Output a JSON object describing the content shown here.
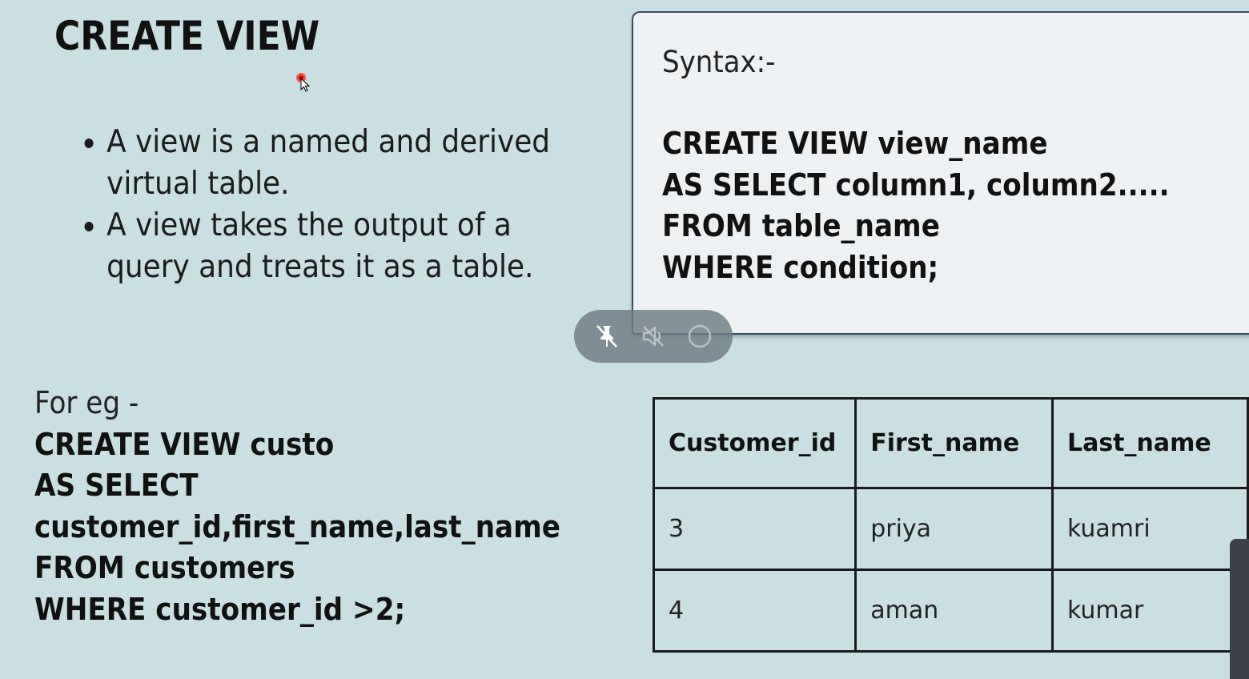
{
  "slide": {
    "title": "CREATE  VIEW",
    "bullets": [
      "A view is a named and derived virtual table.",
      "A view takes the output of a query and treats it as a table."
    ]
  },
  "syntax": {
    "heading": "Syntax:-",
    "lines": [
      "CREATE VIEW view_name",
      "AS SELECT column1, column2.....",
      "FROM table_name",
      "WHERE condition;"
    ]
  },
  "example": {
    "intro": "For eg -",
    "lines": [
      "CREATE VIEW custo",
      "AS SELECT",
      "customer_id,first_name,last_name",
      "FROM customers",
      "WHERE customer_id >2;"
    ]
  },
  "table": {
    "columns": [
      "Customer_id",
      "First_name",
      "Last_name"
    ],
    "rows": [
      [
        "3",
        "priya",
        "kuamri"
      ],
      [
        "4",
        "aman",
        "kumar"
      ]
    ]
  },
  "overlay_controls": {
    "icons": [
      "unpin-icon",
      "mute-icon",
      "record-icon"
    ],
    "bar_color": "#6e7d82"
  },
  "colors": {
    "background": "#c9dfe2",
    "card": "#eef1f4",
    "card_border": "#3a4b66"
  }
}
